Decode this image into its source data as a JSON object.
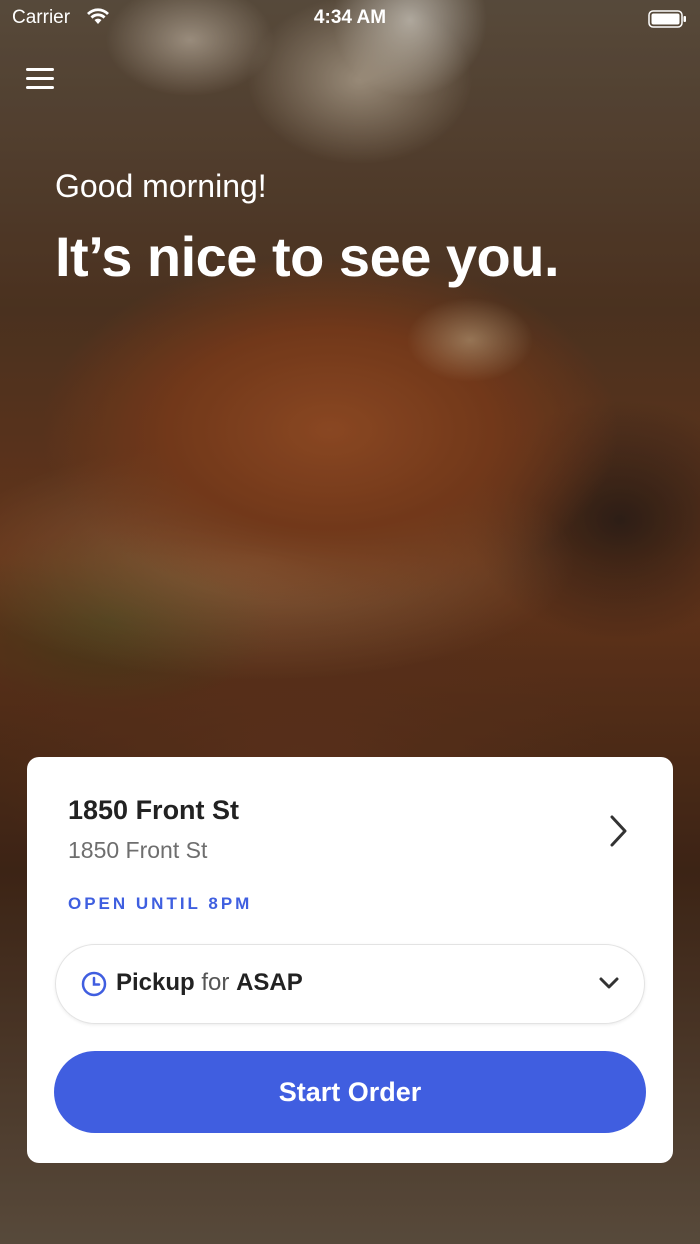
{
  "status_bar": {
    "carrier": "Carrier",
    "time": "4:34 AM"
  },
  "hero": {
    "greeting": "Good morning!",
    "headline": "It’s nice to see you."
  },
  "store": {
    "name": "1850 Front St",
    "address": "1850 Front St",
    "hours": "OPEN UNTIL 8PM"
  },
  "order_mode": {
    "mode": "Pickup",
    "connector": "for",
    "time": "ASAP"
  },
  "cta": {
    "label": "Start Order"
  },
  "colors": {
    "accent": "#405ee0",
    "card": "#ffffff"
  },
  "icons": [
    "menu-icon",
    "wifi-icon",
    "battery-icon",
    "chevron-right-icon",
    "clock-icon",
    "chevron-down-icon"
  ]
}
